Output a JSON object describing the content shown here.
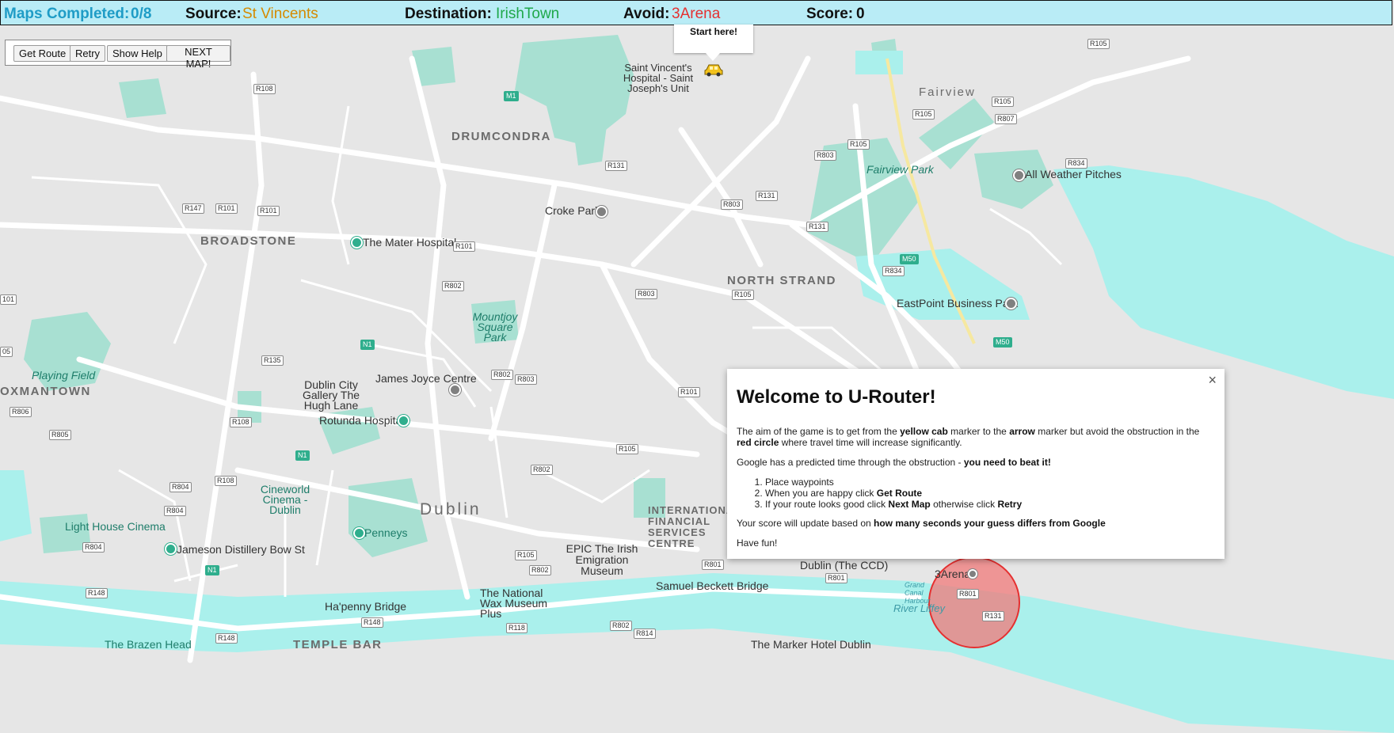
{
  "status_bar": {
    "maps_completed_label": "Maps Completed:",
    "maps_completed_value": "0/8",
    "source_label": "Source:",
    "source_value": "St Vincents",
    "destination_label": "Destination:",
    "destination_value": "IrishTown",
    "avoid_label": "Avoid:",
    "avoid_value": "3Arena",
    "score_label": "Score:",
    "score_value": "0"
  },
  "controls": {
    "get_route": "Get Route",
    "retry": "Retry",
    "show_help": "Show Help",
    "next_map": "NEXT MAP!"
  },
  "start_marker": {
    "label": "Start here!",
    "icon": "car-icon"
  },
  "avoid_zone": {
    "color": "#e53030",
    "label": "3Arena"
  },
  "map_labels": {
    "drumcondra": "DRUMCONDRA",
    "broadstone": "BROADSTONE",
    "north_strand": "NORTH STRAND",
    "dublin": "Dublin",
    "temple_bar": "TEMPLE BAR",
    "fairview": "Fairview",
    "oxmantown": "OXMANTOWN",
    "intl_financial": "INTERNATIONAL FINANCIAL SERVICES CENTRE",
    "st_vincents": "Saint Vincent's Hospital - Saint Joseph's Unit",
    "croke_park": "Croke Park",
    "mater": "The Mater Hospital",
    "mountjoy": "Mountjoy Square Park",
    "fairview_park": "Fairview Park",
    "all_weather": "All Weather Pitches",
    "eastpoint": "EastPoint Business Park",
    "james_joyce": "James Joyce Centre",
    "hugh_lane": "Dublin City Gallery The Hugh Lane",
    "rotunda": "Rotunda Hospital",
    "playing_field": "Playing Field",
    "cineworld": "Cineworld Cinema - Dublin",
    "penneys": "Penneys",
    "light_house": "Light House Cinema",
    "jameson": "Jameson Distillery Bow St",
    "epic": "EPIC The Irish Emigration Museum",
    "ccd": "Dublin (The CCD)",
    "beckett": "Samuel Beckett Bridge",
    "wax": "The National Wax Museum Plus",
    "hapenny": "Ha'penny Bridge",
    "brazen": "The Brazen Head",
    "marker_hotel": "The Marker Hotel Dublin",
    "liffey": "River Liffey",
    "arena": "3Arena",
    "grand_canal": "Grand Canal Harbour"
  },
  "dialog": {
    "title": "Welcome to U-Router!",
    "p1_a": "The aim of the game is to get from the ",
    "p1_b": "yellow cab",
    "p1_c": " marker to the ",
    "p1_d": "arrow",
    "p1_e": " marker but avoid the obstruction in the ",
    "p1_f": "red circle",
    "p1_g": " where travel time will increase significantly.",
    "p2_a": "Google has a predicted time through the obstruction - ",
    "p2_b": "you need to beat it!",
    "steps": {
      "s1": "Place waypoints",
      "s2_a": "When you are happy click ",
      "s2_b": "Get Route",
      "s3_a": "If your route looks good click ",
      "s3_b": "Next Map",
      "s3_c": " otherwise click ",
      "s3_d": "Retry"
    },
    "p3_a": "Your score will update based on ",
    "p3_b": "how many seconds your guess differs from Google",
    "p4": "Have fun!",
    "close": "×"
  }
}
